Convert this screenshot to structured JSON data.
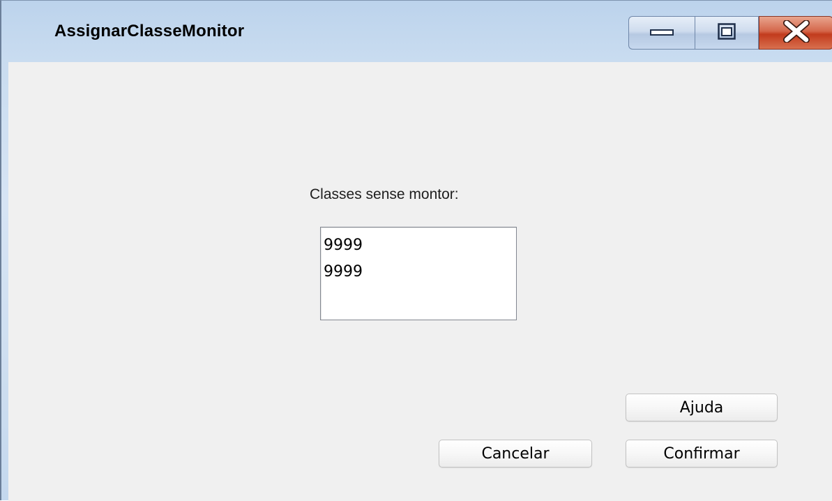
{
  "window": {
    "title": "AssignarClasseMonitor",
    "controls": {
      "minimize": "minimize-icon",
      "maximize": "maximize-icon",
      "close": "close-icon"
    }
  },
  "main": {
    "label": "Classes sense montor:",
    "list_items": [
      "9999",
      "9999"
    ]
  },
  "buttons": {
    "help": "Ajuda",
    "cancel": "Cancelar",
    "confirm": "Confirmar"
  },
  "colors": {
    "close_button": "#c9472a",
    "content_background": "#f0f0f0",
    "title_bar": "#c9dcf0"
  }
}
